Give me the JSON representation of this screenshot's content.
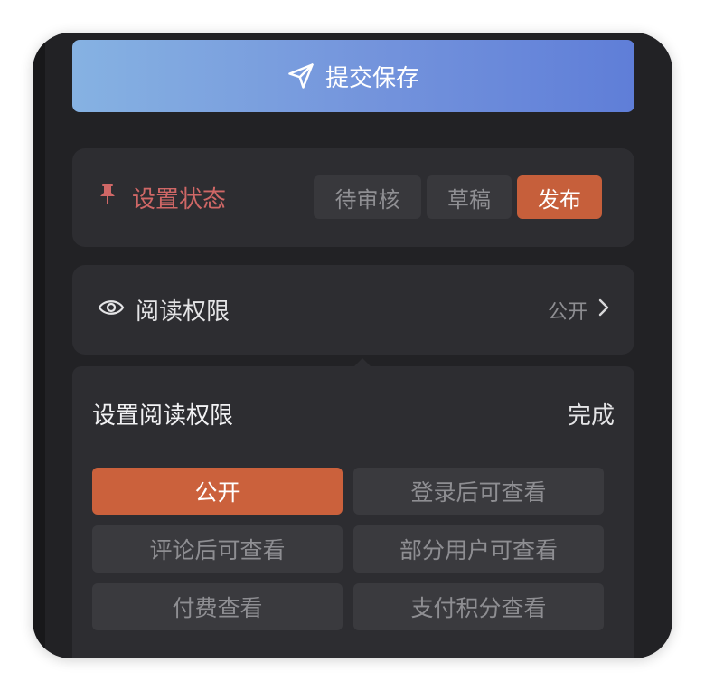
{
  "submit": {
    "label": "提交保存",
    "icon": "paper-plane-icon"
  },
  "status": {
    "label": "设置状态",
    "icon": "pin-icon",
    "options": [
      "待审核",
      "草稿",
      "发布"
    ],
    "selected": "发布"
  },
  "read_permission": {
    "label": "阅读权限",
    "icon": "eye-icon",
    "value": "公开",
    "chevron_icon": "chevron-right-icon"
  },
  "panel": {
    "title": "设置阅读权限",
    "done_label": "完成",
    "options": [
      "公开",
      "登录后可查看",
      "评论后可查看",
      "部分用户可查看",
      "付费查看",
      "支付积分查看"
    ],
    "selected": "公开"
  },
  "colors": {
    "accent": "#cb613c",
    "status_label": "#cf6766",
    "gradient_start": "#86b2e2",
    "gradient_end": "#5f7ed8",
    "background": "#222225",
    "card": "#2d2d31"
  }
}
